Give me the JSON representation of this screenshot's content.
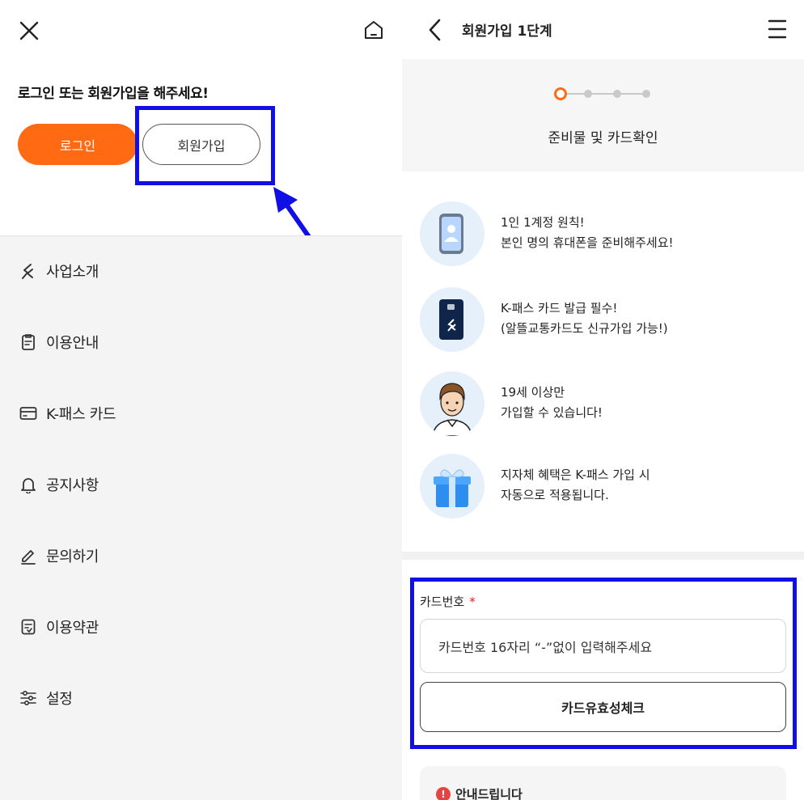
{
  "left": {
    "prompt": "로그인 또는 회원가입을 해주세요!",
    "login_label": "로그인",
    "join_label": "회원가입",
    "menu": [
      {
        "label": "사업소개",
        "icon": "k-logo-icon"
      },
      {
        "label": "이용안내",
        "icon": "clipboard-icon"
      },
      {
        "label": "K-패스 카드",
        "icon": "credit-card-icon"
      },
      {
        "label": "공지사항",
        "icon": "bell-icon"
      },
      {
        "label": "문의하기",
        "icon": "pencil-icon"
      },
      {
        "label": "이용약관",
        "icon": "document-check-icon"
      },
      {
        "label": "설정",
        "icon": "sliders-icon"
      }
    ]
  },
  "right": {
    "title": "회원가입 1단계",
    "step_label": "준비물 및 카드확인",
    "steps_total": 4,
    "current_step": 1,
    "info": [
      {
        "line1": "1인 1계정 원칙!",
        "line2": "본인 명의 휴대폰을 준비해주세요!",
        "icon": "smartphone-icon"
      },
      {
        "line1": "K-패스 카드 발급 필수!",
        "line2": "(알뜰교통카드도 신규가입 가능!)",
        "icon": "kpass-card-icon"
      },
      {
        "line1": "19세 이상만",
        "line2": "가입할 수 있습니다!",
        "icon": "adult-person-icon"
      },
      {
        "line1": "지자체 혜택은 K-패스 가입 시",
        "line2": "자동으로 적용됩니다.",
        "icon": "gift-box-icon"
      }
    ],
    "card_label": "카드번호",
    "required_mark": "*",
    "card_placeholder": "카드번호 16자리 “-”없이 입력해주세요",
    "card_check_label": "카드유효성체크",
    "notice_icon": "!",
    "notice_title": "안내드립니다"
  },
  "colors": {
    "accent_orange": "#ff6a13",
    "highlight_blue": "#1010e6",
    "required_red": "#e32121"
  }
}
